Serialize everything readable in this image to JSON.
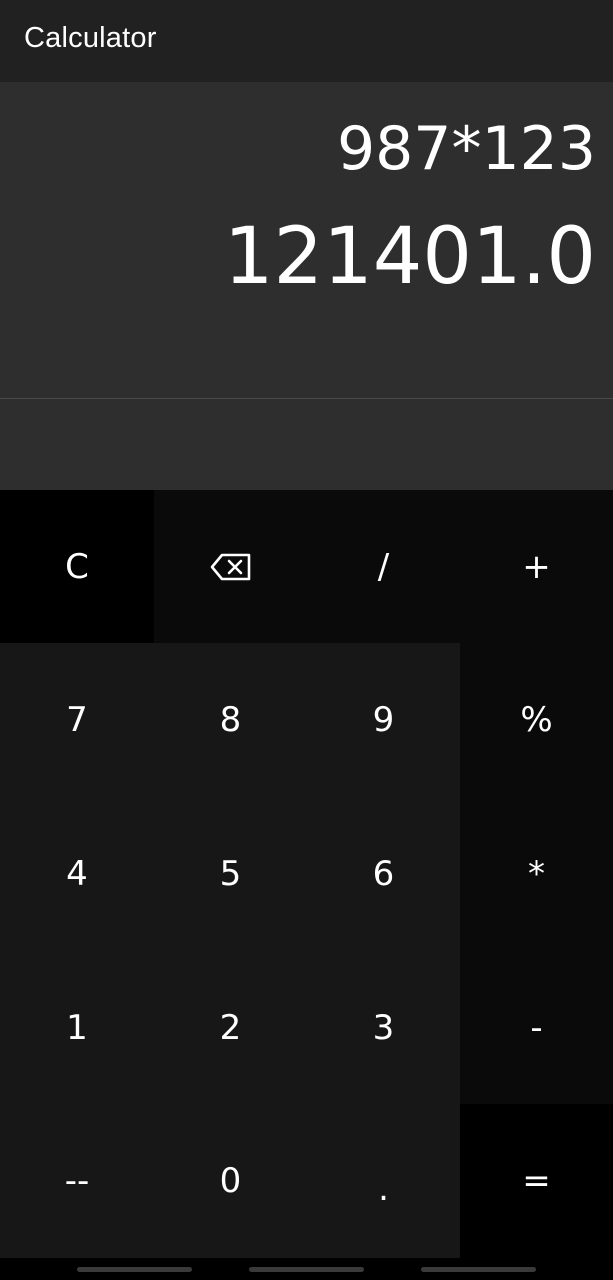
{
  "app_bar": {
    "title": "Calculator"
  },
  "display": {
    "expression": "987*123",
    "result": "121401.0"
  },
  "keypad": {
    "rows": [
      [
        {
          "label": "C",
          "name": "clear-button"
        },
        {
          "label": "",
          "name": "backspace-button",
          "icon": "backspace-icon"
        },
        {
          "label": "/",
          "name": "divide-button"
        },
        {
          "label": "+",
          "name": "plus-button"
        }
      ],
      [
        {
          "label": "7",
          "name": "digit-7-button"
        },
        {
          "label": "8",
          "name": "digit-8-button"
        },
        {
          "label": "9",
          "name": "digit-9-button"
        },
        {
          "label": "%",
          "name": "percent-button"
        }
      ],
      [
        {
          "label": "4",
          "name": "digit-4-button"
        },
        {
          "label": "5",
          "name": "digit-5-button"
        },
        {
          "label": "6",
          "name": "digit-6-button"
        },
        {
          "label": "*",
          "name": "multiply-button"
        }
      ],
      [
        {
          "label": "1",
          "name": "digit-1-button"
        },
        {
          "label": "2",
          "name": "digit-2-button"
        },
        {
          "label": "3",
          "name": "digit-3-button"
        },
        {
          "label": "-",
          "name": "minus-button"
        }
      ],
      [
        {
          "label": "--",
          "name": "negate-button"
        },
        {
          "label": "0",
          "name": "digit-0-button"
        },
        {
          "label": ".",
          "name": "decimal-button"
        },
        {
          "label": "=",
          "name": "equals-button"
        }
      ]
    ]
  },
  "colors": {
    "app_bar_bg": "#212121",
    "display_bg": "#2e2e2e",
    "number_key_bg": "#171717",
    "operator_key_bg": "#0a0a0a",
    "text": "#ffffff"
  }
}
